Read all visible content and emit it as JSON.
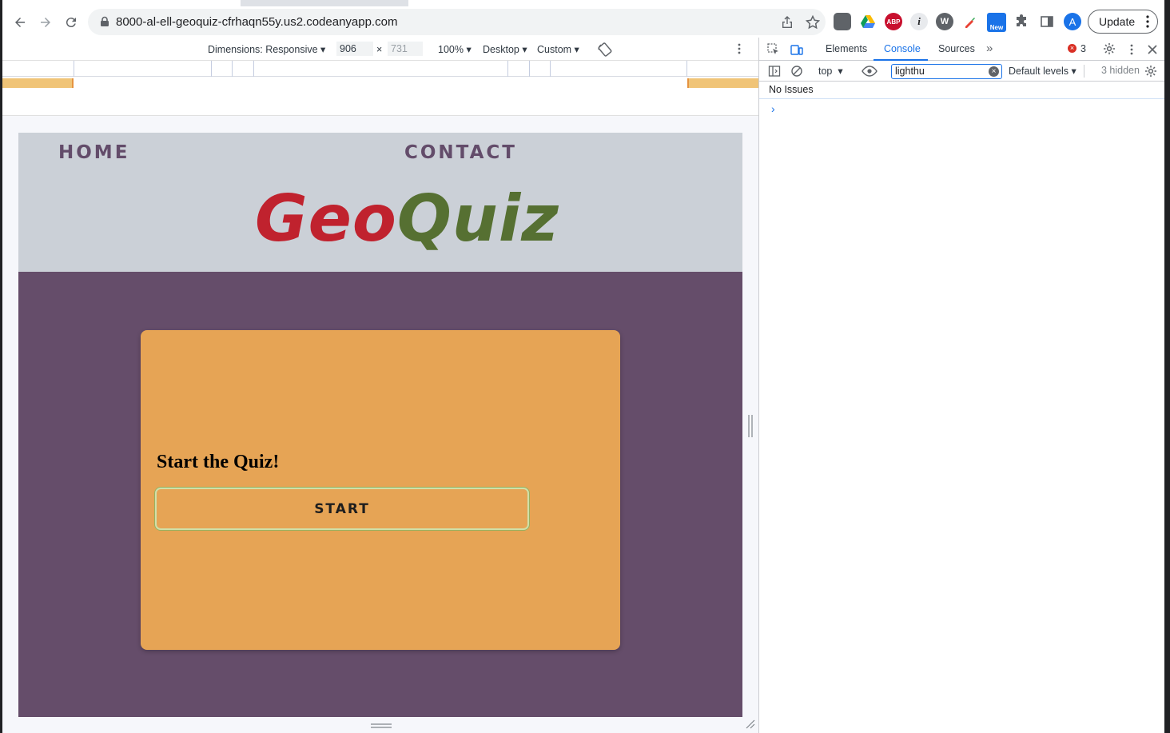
{
  "browser": {
    "url": "8000-al-ell-geoquiz-cfrhaqn55y.us2.codeanyapp.com",
    "update_label": "Update",
    "profile_initial": "A",
    "new_badge": "New",
    "abp_badge": "ABP"
  },
  "device_toolbar": {
    "dimensions_label": "Dimensions: Responsive",
    "width": "906",
    "times": "×",
    "height": "731",
    "zoom": "100%",
    "device_type": "Desktop",
    "throttle": "Custom"
  },
  "site": {
    "nav": {
      "home": "HOME",
      "contact": "CONTACT"
    },
    "logo": {
      "geo": "Geo",
      "quiz": "Quiz"
    },
    "card": {
      "heading": "Start the Quiz!",
      "start_label": "START"
    }
  },
  "devtools": {
    "tabs": {
      "elements": "Elements",
      "console": "Console",
      "sources": "Sources"
    },
    "error_count": "3",
    "context": "top",
    "filter_value": "lighthu",
    "levels": "Default levels",
    "hidden": "3 hidden",
    "issues": "No Issues",
    "prompt": "›"
  },
  "colors": {
    "header_bg": "#cbd0d7",
    "main_bg": "#654d6a",
    "card_bg": "#e6a455",
    "logo_geo": "#c0222e",
    "logo_quiz": "#567032",
    "accent": "#1a73e8"
  }
}
